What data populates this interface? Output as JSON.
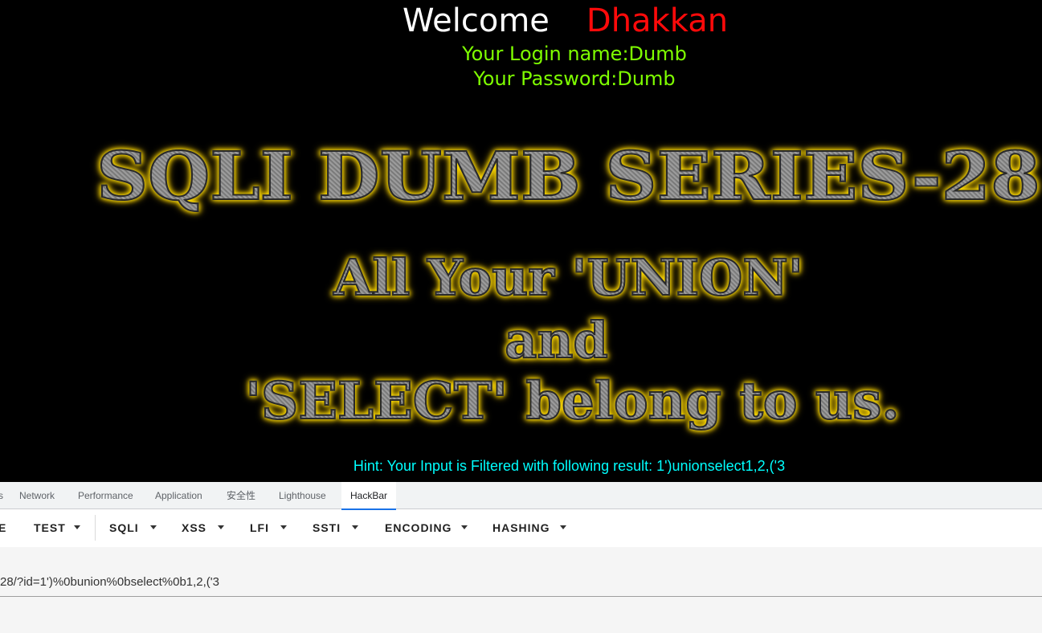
{
  "page": {
    "welcome": "Welcome",
    "user": "Dhakkan",
    "login_name": "Your Login name:Dumb",
    "password": "Your Password:Dumb",
    "title": "SQLI DUMB SERIES-28",
    "banner_line1": "All Your 'UNION'",
    "banner_line2": "and",
    "banner_line3": "'SELECT' belong to us.",
    "hint": "Hint: Your Input is Filtered with following result: 1')\u000bunion\u000bselect\u000b1,2,('3"
  },
  "devtools": {
    "tabs": [
      {
        "label": "s"
      },
      {
        "label": "Network"
      },
      {
        "label": "Performance"
      },
      {
        "label": "Application"
      },
      {
        "label": "安全性"
      },
      {
        "label": "Lighthouse"
      },
      {
        "label": "HackBar",
        "active": true
      }
    ],
    "menus": [
      {
        "label": "E",
        "dropdown": false
      },
      {
        "label": "TEST",
        "dropdown": true
      },
      {
        "label": "SQLI",
        "dropdown": true
      },
      {
        "label": "XSS",
        "dropdown": true
      },
      {
        "label": "LFI",
        "dropdown": true
      },
      {
        "label": "SSTI",
        "dropdown": true
      },
      {
        "label": "ENCODING",
        "dropdown": true
      },
      {
        "label": "HASHING",
        "dropdown": true
      }
    ],
    "url_value": "28/?id=1')%0bunion%0bselect%0b1,2,('3"
  },
  "icons": [
    "dropdown-caret-icon"
  ],
  "colors": {
    "welcome": "#ffffff",
    "user": "#ff0a0a",
    "login": "#7fff00",
    "hint": "#00ffff",
    "active_tab_underline": "#1a73e8"
  }
}
